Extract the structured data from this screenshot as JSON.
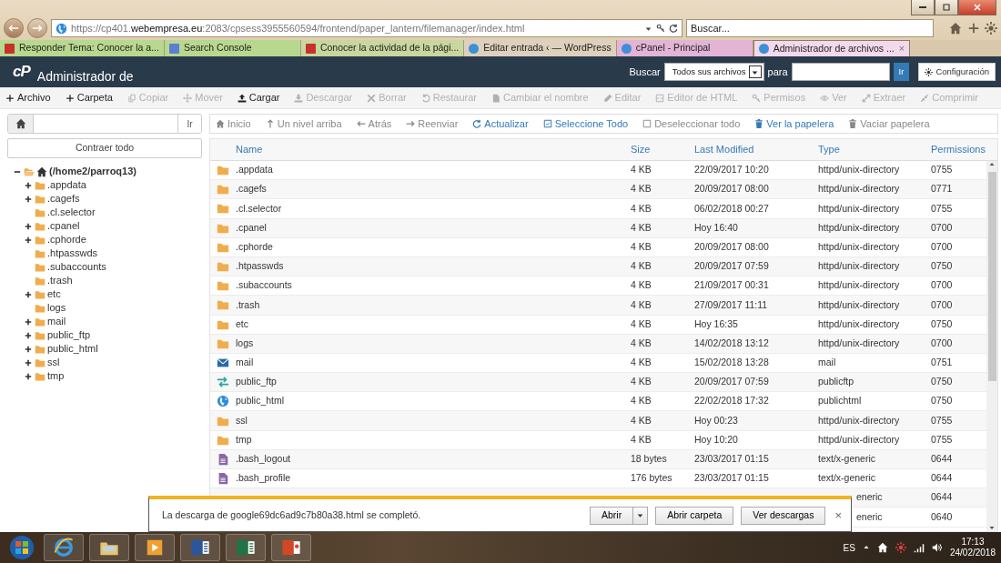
{
  "browser": {
    "address": "https://cp401.**webempresa.eu**:2083/cpsess3955560594/frontend/paper_lantern/filemanager/index.html",
    "search_placeholder": "Buscar...",
    "tabs": [
      {
        "label": "Responder Tema: Conocer la a...",
        "color": "#b9d88f",
        "kind": "red",
        "selected": false
      },
      {
        "label": "Search Console",
        "color": "#b9d88f",
        "kind": "blue",
        "selected": false
      },
      {
        "label": "Conocer la actividad de la pági...",
        "color": "#c8d79e",
        "kind": "red",
        "selected": false
      },
      {
        "label": "Editar entrada ‹ — WordPress",
        "color": "#ddd0bc",
        "kind": "ie",
        "selected": false
      },
      {
        "label": "cPanel - Principal",
        "color": "#e2b4d6",
        "kind": "ie",
        "selected": false
      },
      {
        "label": "Administrador de archivos ...",
        "color": "#f2d9ec",
        "kind": "ie",
        "selected": true,
        "close": "×"
      }
    ]
  },
  "header": {
    "logo": "cP",
    "title": "Administrador de",
    "search_label": "Buscar",
    "scope": "Todos sus archivos",
    "for_label": "para",
    "go": "Ir",
    "settings": "Configuración"
  },
  "toolbar": [
    {
      "label": "Archivo",
      "kind": "plus",
      "disabled": false
    },
    {
      "label": "Carpeta",
      "kind": "plus",
      "disabled": false
    },
    {
      "label": "Copiar",
      "kind": "copy",
      "disabled": true
    },
    {
      "label": "Mover",
      "kind": "move",
      "disabled": true
    },
    {
      "label": "Cargar",
      "kind": "upload",
      "disabled": false
    },
    {
      "label": "Descargar",
      "kind": "download",
      "disabled": true
    },
    {
      "label": "Borrar",
      "kind": "x",
      "disabled": true
    },
    {
      "label": "Restaurar",
      "kind": "undo",
      "disabled": true
    },
    {
      "label": "Cambiar el nombre",
      "kind": "file",
      "disabled": true
    },
    {
      "label": "Editar",
      "kind": "pencil",
      "disabled": true
    },
    {
      "label": "Editor de HTML",
      "kind": "code",
      "disabled": true
    },
    {
      "label": "Permisos",
      "kind": "key",
      "disabled": true
    },
    {
      "label": "Ver",
      "kind": "eye",
      "disabled": true
    },
    {
      "label": "Extraer",
      "kind": "expand",
      "disabled": true
    },
    {
      "label": "Comprimir",
      "kind": "compress",
      "disabled": true
    }
  ],
  "sidebar": {
    "go": "Ir",
    "collapse": "Contraer todo",
    "tree": {
      "label": "(/home2/parroq13)",
      "expanded": true,
      "children": [
        {
          "label": ".appdata",
          "has_children": true
        },
        {
          "label": ".cagefs",
          "has_children": true
        },
        {
          "label": ".cl.selector",
          "has_children": false
        },
        {
          "label": ".cpanel",
          "has_children": true
        },
        {
          "label": ".cphorde",
          "has_children": true
        },
        {
          "label": ".htpasswds",
          "has_children": false
        },
        {
          "label": ".subaccounts",
          "has_children": false
        },
        {
          "label": ".trash",
          "has_children": false
        },
        {
          "label": "etc",
          "has_children": true
        },
        {
          "label": "logs",
          "has_children": false
        },
        {
          "label": "mail",
          "has_children": true
        },
        {
          "label": "public_ftp",
          "has_children": true
        },
        {
          "label": "public_html",
          "has_children": true
        },
        {
          "label": "ssl",
          "has_children": true
        },
        {
          "label": "tmp",
          "has_children": true
        }
      ]
    }
  },
  "navbar": [
    {
      "label": "Inicio",
      "kind": "home",
      "disabled": true
    },
    {
      "label": "Un nivel arriba",
      "kind": "up",
      "disabled": true
    },
    {
      "label": "Atrás",
      "kind": "left",
      "disabled": true
    },
    {
      "label": "Reenviar",
      "kind": "right",
      "disabled": true
    },
    {
      "label": "Actualizar",
      "kind": "refresh",
      "disabled": false
    },
    {
      "label": "Seleccione Todo",
      "kind": "checksq",
      "disabled": false
    },
    {
      "label": "Deseleccionar todo",
      "kind": "square",
      "disabled": true
    },
    {
      "label": "Ver la papelera",
      "kind": "trash",
      "disabled": false
    },
    {
      "label": "Vaciar papelera",
      "kind": "trash",
      "disabled": true
    }
  ],
  "table": {
    "columns": [
      "Name",
      "Size",
      "Last Modified",
      "Type",
      "Permissions"
    ],
    "rows": [
      {
        "kind": "folder",
        "name": ".appdata",
        "size": "4 KB",
        "modified": "22/09/2017 10:20",
        "type": "httpd/unix-directory",
        "permissions": "0755"
      },
      {
        "kind": "folder",
        "name": ".cagefs",
        "size": "4 KB",
        "modified": "20/09/2017 08:00",
        "type": "httpd/unix-directory",
        "permissions": "0771"
      },
      {
        "kind": "folder",
        "name": ".cl.selector",
        "size": "4 KB",
        "modified": "06/02/2018 00:27",
        "type": "httpd/unix-directory",
        "permissions": "0755"
      },
      {
        "kind": "folder",
        "name": ".cpanel",
        "size": "4 KB",
        "modified": "Hoy 16:40",
        "type": "httpd/unix-directory",
        "permissions": "0700"
      },
      {
        "kind": "folder",
        "name": ".cphorde",
        "size": "4 KB",
        "modified": "20/09/2017 08:00",
        "type": "httpd/unix-directory",
        "permissions": "0700"
      },
      {
        "kind": "folder",
        "name": ".htpasswds",
        "size": "4 KB",
        "modified": "20/09/2017 07:59",
        "type": "httpd/unix-directory",
        "permissions": "0750"
      },
      {
        "kind": "folder",
        "name": ".subaccounts",
        "size": "4 KB",
        "modified": "21/09/2017 00:31",
        "type": "httpd/unix-directory",
        "permissions": "0700"
      },
      {
        "kind": "folder",
        "name": ".trash",
        "size": "4 KB",
        "modified": "27/09/2017 11:11",
        "type": "httpd/unix-directory",
        "permissions": "0700"
      },
      {
        "kind": "folder",
        "name": "etc",
        "size": "4 KB",
        "modified": "Hoy 16:35",
        "type": "httpd/unix-directory",
        "permissions": "0750"
      },
      {
        "kind": "folder",
        "name": "logs",
        "size": "4 KB",
        "modified": "14/02/2018 13:12",
        "type": "httpd/unix-directory",
        "permissions": "0700"
      },
      {
        "kind": "mail",
        "name": "mail",
        "size": "4 KB",
        "modified": "15/02/2018 13:28",
        "type": "mail",
        "permissions": "0751"
      },
      {
        "kind": "ftp",
        "name": "public_ftp",
        "size": "4 KB",
        "modified": "20/09/2017 07:59",
        "type": "publicftp",
        "permissions": "0750"
      },
      {
        "kind": "web",
        "name": "public_html",
        "size": "4 KB",
        "modified": "22/02/2018 17:32",
        "type": "publichtml",
        "permissions": "0750"
      },
      {
        "kind": "folder",
        "name": "ssl",
        "size": "4 KB",
        "modified": "Hoy 00:23",
        "type": "httpd/unix-directory",
        "permissions": "0755"
      },
      {
        "kind": "folder",
        "name": "tmp",
        "size": "4 KB",
        "modified": "Hoy 10:20",
        "type": "httpd/unix-directory",
        "permissions": "0755"
      },
      {
        "kind": "file",
        "name": ".bash_logout",
        "size": "18 bytes",
        "modified": "23/03/2017 01:15",
        "type": "text/x-generic",
        "permissions": "0644"
      },
      {
        "kind": "file",
        "name": ".bash_profile",
        "size": "176 bytes",
        "modified": "23/03/2017 01:15",
        "type": "text/x-generic",
        "permissions": "0644"
      },
      {
        "kind": "covered",
        "type": "eneric",
        "permissions": "0644"
      },
      {
        "kind": "covered",
        "type": "eneric",
        "permissions": "0640"
      }
    ]
  },
  "download_bar": {
    "message": "La descarga de google69dc6ad9c7b80a38.html se completó.",
    "open": "Abrir",
    "open_folder": "Abrir carpeta",
    "view": "Ver descargas",
    "close": "×"
  },
  "taskbar": {
    "apps": [
      {
        "kind": "start"
      },
      {
        "kind": "ie"
      },
      {
        "kind": "explorer"
      },
      {
        "kind": "media"
      },
      {
        "kind": "word"
      },
      {
        "kind": "excel"
      },
      {
        "kind": "powerpoint"
      }
    ],
    "language": "ES",
    "time": "17:13",
    "date": "24/02/2018"
  }
}
